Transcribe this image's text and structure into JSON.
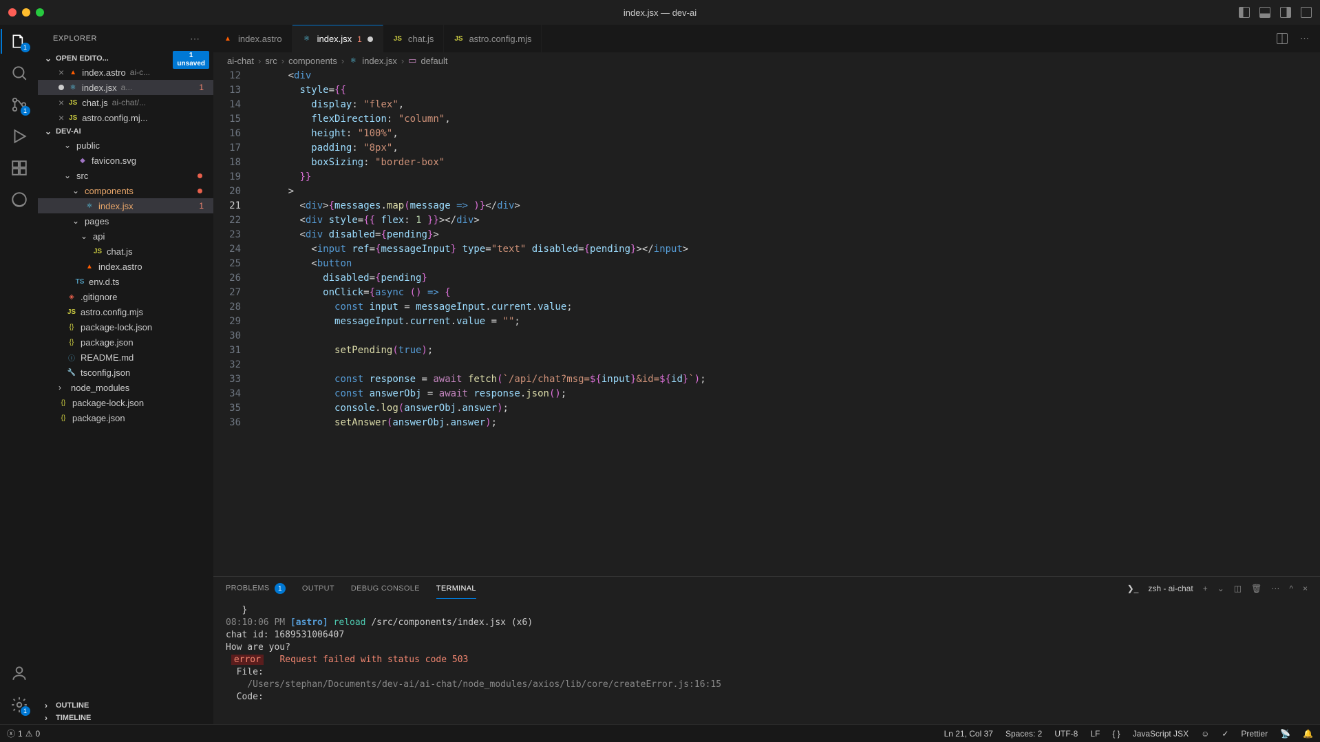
{
  "window": {
    "title": "index.jsx — dev-ai"
  },
  "activity": {
    "explorer_badge": "1",
    "scm_badge": "1"
  },
  "sidebar": {
    "title": "EXPLORER",
    "open_editors_label": "OPEN EDITO...",
    "unsaved": {
      "count": "1",
      "label": "unsaved"
    },
    "files": {
      "astro": "index.astro",
      "astro_tail": "ai-c...",
      "jsx": "index.jsx",
      "jsx_tail": "a...",
      "jsx_err": "1",
      "chatjs": "chat.js",
      "chatjs_tail": "ai-chat/...",
      "config": "astro.config.mj..."
    },
    "project": "DEV-AI",
    "tree": {
      "nm_trunc": "node_modules",
      "public": "public",
      "favicon": "favicon.svg",
      "src": "src",
      "components": "components",
      "indexjsx": "index.jsx",
      "indexjsx_err": "1",
      "pages": "pages",
      "api": "api",
      "chatjs": "chat.js",
      "indexastro": "index.astro",
      "envdts": "env.d.ts",
      "gitignore": ".gitignore",
      "astroconfig": "astro.config.mjs",
      "pkglock": "package-lock.json",
      "pkg": "package.json",
      "readme": "README.md",
      "tsconfig": "tsconfig.json",
      "nm2": "node_modules",
      "pkglock2": "package-lock.json",
      "pkg2": "package.json"
    },
    "outline": "OUTLINE",
    "timeline": "TIMELINE"
  },
  "tabs": {
    "t1": "index.astro",
    "t2": "index.jsx",
    "t2_err": "1",
    "t3": "chat.js",
    "t4": "astro.config.mjs"
  },
  "breadcrumb": {
    "p1": "ai-chat",
    "p2": "src",
    "p3": "components",
    "p4": "index.jsx",
    "p5": "default"
  },
  "code": {
    "lines": [
      "12",
      "13",
      "14",
      "15",
      "16",
      "17",
      "18",
      "19",
      "20",
      "21",
      "22",
      "23",
      "24",
      "25",
      "26",
      "27",
      "28",
      "29",
      "30",
      "31",
      "32",
      "33",
      "34",
      "35",
      "36"
    ]
  },
  "panel": {
    "problems": "PROBLEMS",
    "problems_count": "1",
    "output": "OUTPUT",
    "debug": "DEBUG CONSOLE",
    "terminal": "TERMINAL",
    "shell": "zsh - ai-chat"
  },
  "terminal": {
    "l1_brace": "}",
    "l2_time": "08:10:06 PM",
    "l2_astro": "[astro]",
    "l2_reload": "reload",
    "l2_path": "/src/components/index.jsx (x6)",
    "l3": "chat id: 1689531006407",
    "l4": "How are you?",
    "l5_err": "error",
    "l5_msg": "   Request failed with status code 503",
    "l6_label": "  File:",
    "l6_path": "    /Users/stephan/Documents/dev-ai/ai-chat/node_modules/axios/lib/core/createError.js:16:15",
    "l7": "  Code:"
  },
  "status": {
    "err": "1",
    "warn": "0",
    "pos": "Ln 21, Col 37",
    "spaces": "Spaces: 2",
    "enc": "UTF-8",
    "eol": "LF",
    "lang": "JavaScript JSX",
    "prettier": "Prettier"
  }
}
